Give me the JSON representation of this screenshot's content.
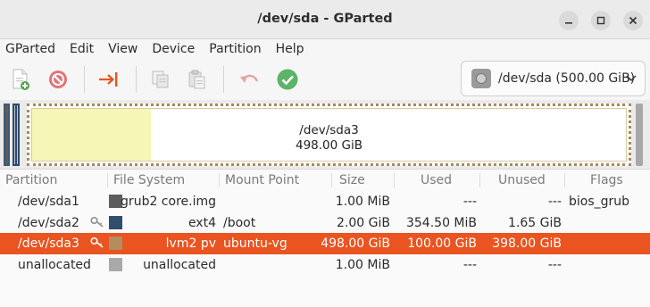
{
  "window": {
    "title": "/dev/sda - GParted"
  },
  "menu": [
    "GParted",
    "Edit",
    "View",
    "Device",
    "Partition",
    "Help"
  ],
  "toolbar": {
    "buttons": [
      {
        "name": "new-partition",
        "icon": "new-document-icon"
      },
      {
        "name": "delete-partition",
        "icon": "delete-icon"
      },
      {
        "name": "resize-move",
        "icon": "resize-move-icon"
      },
      {
        "name": "copy",
        "icon": "copy-icon"
      },
      {
        "name": "paste",
        "icon": "paste-icon"
      },
      {
        "name": "undo",
        "icon": "undo-icon"
      },
      {
        "name": "apply",
        "icon": "apply-check-icon"
      }
    ],
    "device": "/dev/sda (500.00 GiB)"
  },
  "map": {
    "name": "/dev/sda3",
    "size": "498.00 GiB",
    "used_fraction": 0.2
  },
  "columns": [
    "Partition",
    "File System",
    "Mount Point",
    "Size",
    "Used",
    "Unused",
    "Flags"
  ],
  "rows": [
    {
      "partition": "/dev/sda1",
      "fs": "grub2 core.img",
      "mount": "",
      "size": "1.00 MiB",
      "used": "---",
      "unused": "---",
      "flags": "bios_grub",
      "color": "#5d5d5d",
      "key": false,
      "selected": false
    },
    {
      "partition": "/dev/sda2",
      "fs": "ext4",
      "mount": "/boot",
      "size": "2.00 GiB",
      "used": "354.50 MiB",
      "unused": "1.65 GiB",
      "flags": "",
      "color": "#314e6c",
      "key": true,
      "selected": false
    },
    {
      "partition": "/dev/sda3",
      "fs": "lvm2 pv",
      "mount": "ubuntu-vg",
      "size": "498.00 GiB",
      "used": "100.00 GiB",
      "unused": "398.00 GiB",
      "flags": "",
      "color": "#b58c5c",
      "key": true,
      "selected": true
    },
    {
      "partition": "unallocated",
      "fs": "unallocated",
      "mount": "",
      "size": "1.00 MiB",
      "used": "---",
      "unused": "---",
      "flags": "",
      "color": "#a9a9a9",
      "key": false,
      "selected": false
    }
  ],
  "colors": {
    "selection": "#e95420",
    "used_space": "#f6f6b6",
    "lvm_border": "#a88a5a"
  }
}
